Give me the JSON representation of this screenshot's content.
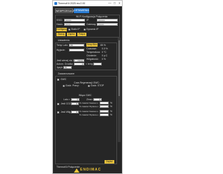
{
  "window": {
    "title": "ThermoKit 2025 rev.2.00",
    "minimize": "—",
    "maximize": "□",
    "close": "×"
  },
  "tabs": [
    {
      "label": "WEBPRZESACAL"
    },
    {
      "label": "USTAWIENIA"
    }
  ],
  "wifi": {
    "title": "Wi-Fi Konfiguracja Połączenia",
    "ssid_label": "SSID:",
    "ssid_value": "••••••••",
    "ip_label": "IP:",
    "ip_value": "•••••••••",
    "haslo_label": "Hasło:",
    "haslo_value": "•••••••",
    "gateway_label": "Gateway:",
    "gateway_value": "••••••••",
    "konfiguruj_button": "Konfiguruj",
    "static_ip_label": "Static IP",
    "dynamic_ip_label": "Dynamic IP",
    "skanuj_button": "Skanuj",
    "zapisz_button": "Zapisz",
    "polacz_button": "Połącz"
  },
  "ustawienia": {
    "title": "Ustawienia",
    "temp_label": "Temp Lato:",
    "temp_value": "19",
    "temp_biez_button": "Temp Biez",
    "temp_biez_value": "85 %",
    "wyjscie_label": "Wyjscie:",
    "czasowe_label": "Czasowe:",
    "czasowe_value": "0.0 %",
    "temperatura_label": "Temperatura:",
    "temperatura_value": "0 °C",
    "cisnienie_label": "Ciśnienie:",
    "cisnienie_value": "0 p.C",
    "wilgotnosc_label": "Wilgotność:",
    "wilgotnosc_value": "0 %",
    "jesli_label": "Jesli wiecej niz 18C",
    "jesli_value": "Ustaw",
    "autom_label": "Autom. Grzałka",
    "autom_value": "1",
    "lt_temp_label": "< temp",
    "jezyk_label": "Język:",
    "jezyk_value": "PL"
  },
  "zaawansowane": {
    "title": "Zaawansowane",
    "gwc_label": "GWC",
    "czas_regeneracji_label": "Czas Regeneracji GWC:",
    "godz_pracy_label": "Godz. Pracy:",
    "godz_stop_label": "Godz. STOP",
    "wlacz_gwc_label": "Włącz GWC",
    "lato_label": "Lato >",
    "lato_value": "0",
    "zima_label": "Zima <",
    "zima_value": "0",
    "jesli_co2_label": "Jesli CO2 >",
    "jesli_co2_value": "0",
    "wlacz_wilg_label": "Jesli Wilg. >",
    "wlacz_wilg_value": "0",
    "zwieksz_label": "% zwieksz Nawiew o",
    "zwieksz_label2": "% zwieksz Wywiew o",
    "pct": "%",
    "zapisz_button": "Zapisz"
  },
  "footer": {
    "thermokit_label": "ThermoKit Połączenie:",
    "brand": "ENDIMAC"
  },
  "colors": {
    "accent": "#e8c23a",
    "tab_active": "#2a7bd1",
    "bg": "#262626"
  }
}
